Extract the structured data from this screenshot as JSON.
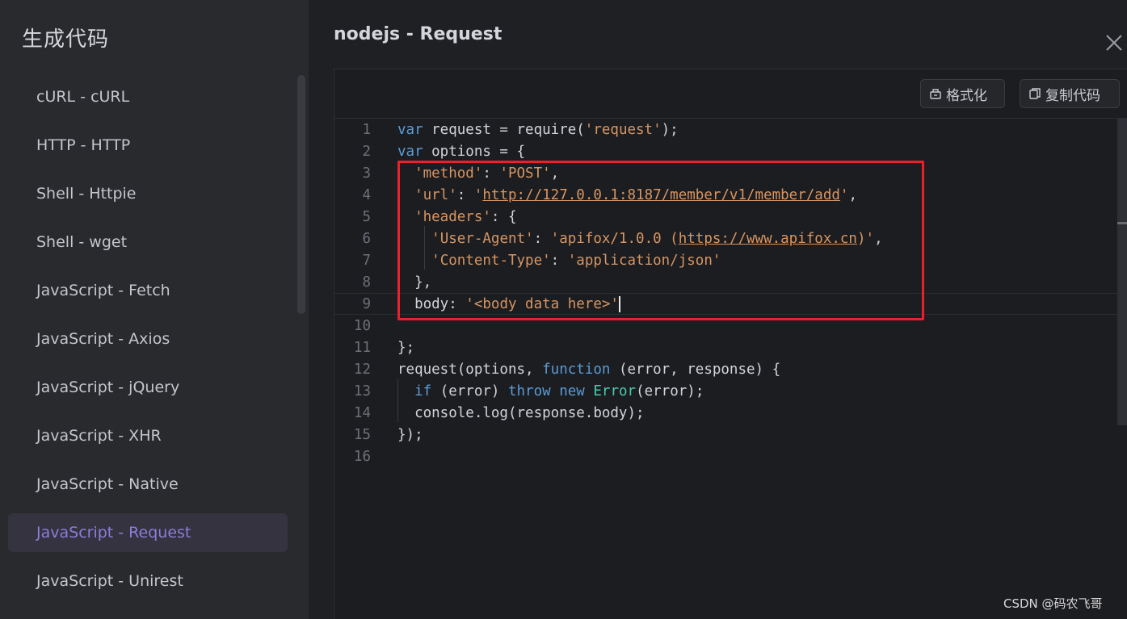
{
  "sidebar": {
    "title": "生成代码",
    "items": [
      {
        "label": "cURL - cURL"
      },
      {
        "label": "HTTP - HTTP"
      },
      {
        "label": "Shell - Httpie"
      },
      {
        "label": "Shell - wget"
      },
      {
        "label": "JavaScript - Fetch"
      },
      {
        "label": "JavaScript - Axios"
      },
      {
        "label": "JavaScript - jQuery"
      },
      {
        "label": "JavaScript - XHR"
      },
      {
        "label": "JavaScript - Native"
      },
      {
        "label": "JavaScript - Request",
        "active": true
      },
      {
        "label": "JavaScript - Unirest"
      }
    ]
  },
  "main": {
    "title": "nodejs - Request",
    "toolbar": {
      "format_label": "格式化",
      "copy_label": "复制代码"
    },
    "current_line": 9,
    "code_lines": [
      {
        "n": "1",
        "tokens": [
          [
            "kw",
            "var"
          ],
          [
            "p",
            " request = require("
          ],
          [
            "s",
            "'request'"
          ],
          [
            "p",
            ");"
          ]
        ]
      },
      {
        "n": "2",
        "tokens": [
          [
            "kw",
            "var"
          ],
          [
            "p",
            " options = {"
          ]
        ]
      },
      {
        "n": "3",
        "tokens": [
          [
            "p",
            "  "
          ],
          [
            "s",
            "'method'"
          ],
          [
            "p",
            ": "
          ],
          [
            "s",
            "'POST'"
          ],
          [
            "p",
            ","
          ]
        ]
      },
      {
        "n": "4",
        "tokens": [
          [
            "p",
            "  "
          ],
          [
            "s",
            "'url'"
          ],
          [
            "p",
            ": "
          ],
          [
            "s",
            "'"
          ],
          [
            "link",
            "http://127.0.0.1:8187/member/v1/member/add"
          ],
          [
            "s",
            "'"
          ],
          [
            "p",
            ","
          ]
        ]
      },
      {
        "n": "5",
        "tokens": [
          [
            "p",
            "  "
          ],
          [
            "s",
            "'headers'"
          ],
          [
            "p",
            ": {"
          ]
        ]
      },
      {
        "n": "6",
        "tokens": [
          [
            "p",
            "    "
          ],
          [
            "s",
            "'User-Agent'"
          ],
          [
            "p",
            ": "
          ],
          [
            "s",
            "'apifox/1.0.0 ("
          ],
          [
            "link",
            "https://www.apifox.cn"
          ],
          [
            "s",
            ")'"
          ],
          [
            "p",
            ","
          ]
        ]
      },
      {
        "n": "7",
        "tokens": [
          [
            "p",
            "    "
          ],
          [
            "s",
            "'Content-Type'"
          ],
          [
            "p",
            ": "
          ],
          [
            "s",
            "'application/json'"
          ]
        ]
      },
      {
        "n": "8",
        "tokens": [
          [
            "p",
            "  },"
          ]
        ]
      },
      {
        "n": "9",
        "tokens": [
          [
            "p",
            "  body: "
          ],
          [
            "s",
            "'<body data here>'"
          ]
        ]
      },
      {
        "n": "10",
        "tokens": []
      },
      {
        "n": "11",
        "tokens": [
          [
            "p",
            "};"
          ]
        ]
      },
      {
        "n": "12",
        "tokens": [
          [
            "p",
            "request(options, "
          ],
          [
            "kw",
            "function"
          ],
          [
            "p",
            " (error, response) {"
          ]
        ]
      },
      {
        "n": "13",
        "tokens": [
          [
            "p",
            "  "
          ],
          [
            "kw",
            "if"
          ],
          [
            "p",
            " (error) "
          ],
          [
            "kw",
            "throw"
          ],
          [
            "p",
            " "
          ],
          [
            "kw",
            "new"
          ],
          [
            "p",
            " "
          ],
          [
            "cls",
            "Error"
          ],
          [
            "p",
            "(error);"
          ]
        ]
      },
      {
        "n": "14",
        "tokens": [
          [
            "p",
            "  console.log(response.body);"
          ]
        ]
      },
      {
        "n": "15",
        "tokens": [
          [
            "p",
            "});"
          ]
        ]
      },
      {
        "n": "16",
        "tokens": []
      }
    ]
  },
  "watermark": "CSDN @码农飞哥",
  "colors": {
    "accent": "#8b7ed8",
    "highlight_box": "#e8222b",
    "keyword": "#5b9bd5",
    "string": "#d69563"
  }
}
